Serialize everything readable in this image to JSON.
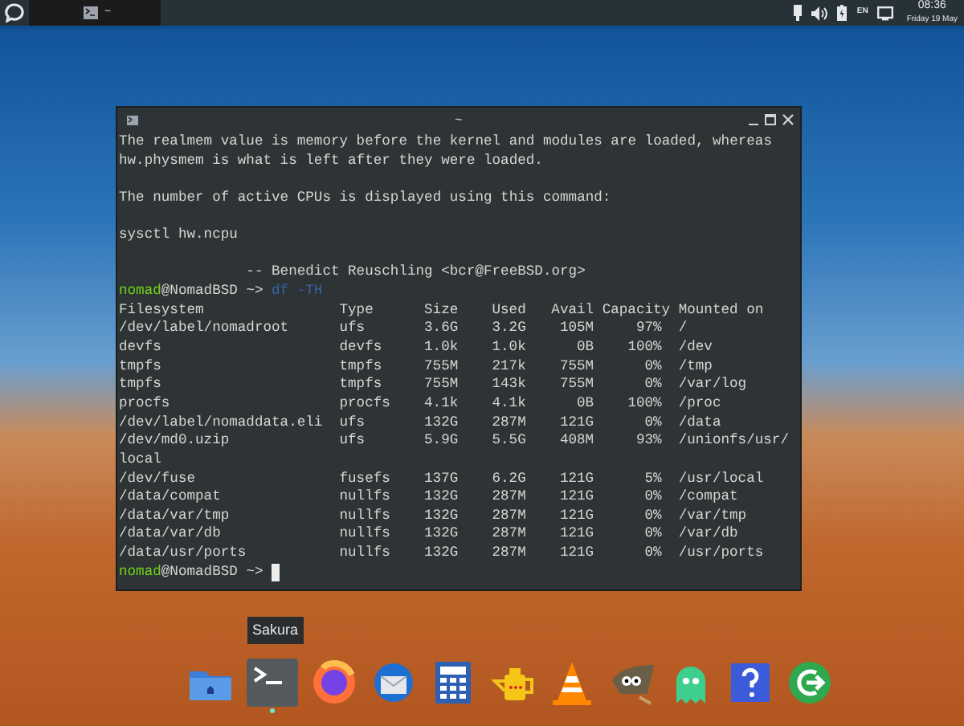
{
  "top_bar": {
    "task": {
      "title": "~",
      "selected": true
    },
    "tray": {
      "language": "EN",
      "time": "08:36",
      "date": "Friday 19 May"
    }
  },
  "terminal": {
    "title": "~",
    "lines": [
      {
        "kind": "text",
        "text": "The realmem value is memory before the kernel and modules are loaded, whereas"
      },
      {
        "kind": "text",
        "text": "hw.physmem is what is left after they were loaded."
      },
      {
        "kind": "blank"
      },
      {
        "kind": "text",
        "text": "The number of active CPUs is displayed using this command:"
      },
      {
        "kind": "blank"
      },
      {
        "kind": "text",
        "text": "sysctl hw.ncpu"
      },
      {
        "kind": "blank"
      },
      {
        "kind": "text",
        "text": "               -- Benedict Reuschling <bcr@FreeBSD.org>"
      },
      {
        "kind": "prompt",
        "user": "nomad",
        "host": "@NomadBSD ~>",
        "command": "df -TH"
      }
    ],
    "table": {
      "columns": [
        "Filesystem",
        "Type",
        "Size",
        "Used",
        "Avail",
        "Capacity",
        "Mounted on"
      ],
      "rows": [
        [
          "/dev/label/nomadroot",
          "ufs",
          "3.6G",
          "3.2G",
          "105M",
          "97%",
          "/"
        ],
        [
          "devfs",
          "devfs",
          "1.0k",
          "1.0k",
          "0B",
          "100%",
          "/dev"
        ],
        [
          "tmpfs",
          "tmpfs",
          "755M",
          "217k",
          "755M",
          "0%",
          "/tmp"
        ],
        [
          "tmpfs",
          "tmpfs",
          "755M",
          "143k",
          "755M",
          "0%",
          "/var/log"
        ],
        [
          "procfs",
          "procfs",
          "4.1k",
          "4.1k",
          "0B",
          "100%",
          "/proc"
        ],
        [
          "/dev/label/nomaddata.eli",
          "ufs",
          "132G",
          "287M",
          "121G",
          "0%",
          "/data"
        ],
        [
          "/dev/md0.uzip",
          "ufs",
          "5.9G",
          "5.5G",
          "408M",
          "93%",
          "/unionfs/usr/"
        ],
        [
          "local"
        ],
        [
          "/dev/fuse",
          "fusefs",
          "137G",
          "6.2G",
          "121G",
          "5%",
          "/usr/local"
        ],
        [
          "/data/compat",
          "nullfs",
          "132G",
          "287M",
          "121G",
          "0%",
          "/compat"
        ],
        [
          "/data/var/tmp",
          "nullfs",
          "132G",
          "287M",
          "121G",
          "0%",
          "/var/tmp"
        ],
        [
          "/data/var/db",
          "nullfs",
          "132G",
          "287M",
          "121G",
          "0%",
          "/var/db"
        ],
        [
          "/data/usr/ports",
          "nullfs",
          "132G",
          "287M",
          "121G",
          "0%",
          "/usr/ports"
        ]
      ]
    },
    "final_prompt": {
      "user": "nomad",
      "host": "@NomadBSD ~>",
      "cursor": true
    }
  },
  "dock": {
    "tooltip": "Sakura",
    "items": [
      {
        "kind": "folder",
        "running": false
      },
      {
        "kind": "terminal",
        "running": true
      },
      {
        "kind": "browser",
        "running": false
      },
      {
        "kind": "mail",
        "running": false
      },
      {
        "kind": "calculator",
        "running": false
      },
      {
        "kind": "teapot",
        "running": false
      },
      {
        "kind": "cone",
        "running": false
      },
      {
        "kind": "creature",
        "running": false
      },
      {
        "kind": "ghost",
        "running": false
      },
      {
        "kind": "help",
        "running": false
      },
      {
        "kind": "logout",
        "running": false
      }
    ]
  }
}
